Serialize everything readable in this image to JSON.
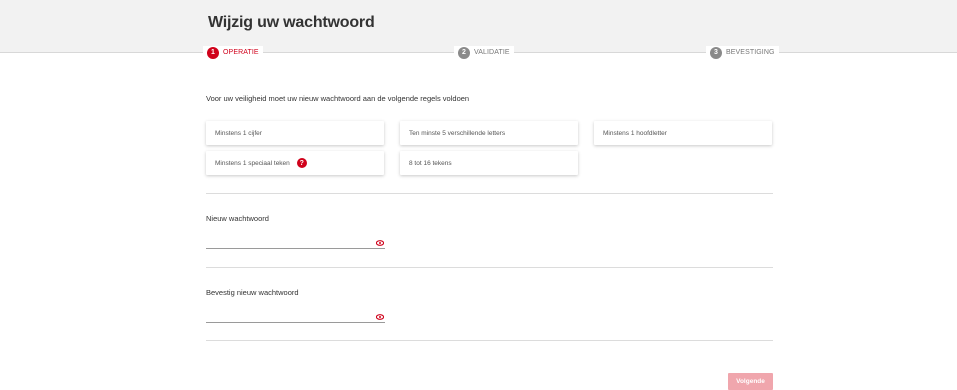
{
  "header": {
    "title": "Wijzig uw wachtwoord"
  },
  "stepper": {
    "steps": [
      {
        "number": "1",
        "label": "OPERATIE",
        "state": "active"
      },
      {
        "number": "2",
        "label": "VALIDATIE",
        "state": "inactive"
      },
      {
        "number": "3",
        "label": "BEVESTIGING",
        "state": "inactive"
      }
    ]
  },
  "rules": {
    "intro": "Voor uw veiligheid moet uw nieuw wachtwoord aan de volgende regels voldoen",
    "items": [
      "Minstens 1 cijfer",
      "Ten minste 5 verschillende letters",
      "Minstens 1 hoofdletter",
      "Minstens 1 speciaal teken",
      "8 tot 16 tekens"
    ],
    "help_icon": "?"
  },
  "form": {
    "new_password": {
      "label": "Nieuw wachtwoord",
      "value": ""
    },
    "confirm_password": {
      "label": "Bevestig nieuw wachtwoord",
      "value": ""
    }
  },
  "actions": {
    "next_label": "Volgende"
  },
  "colors": {
    "accent": "#d0021b",
    "button_disabled": "#f0a6ad",
    "step_inactive": "#8a8a8a"
  },
  "icons": {
    "password_visibility": "eye-icon",
    "rule_help": "help-circle-icon"
  }
}
